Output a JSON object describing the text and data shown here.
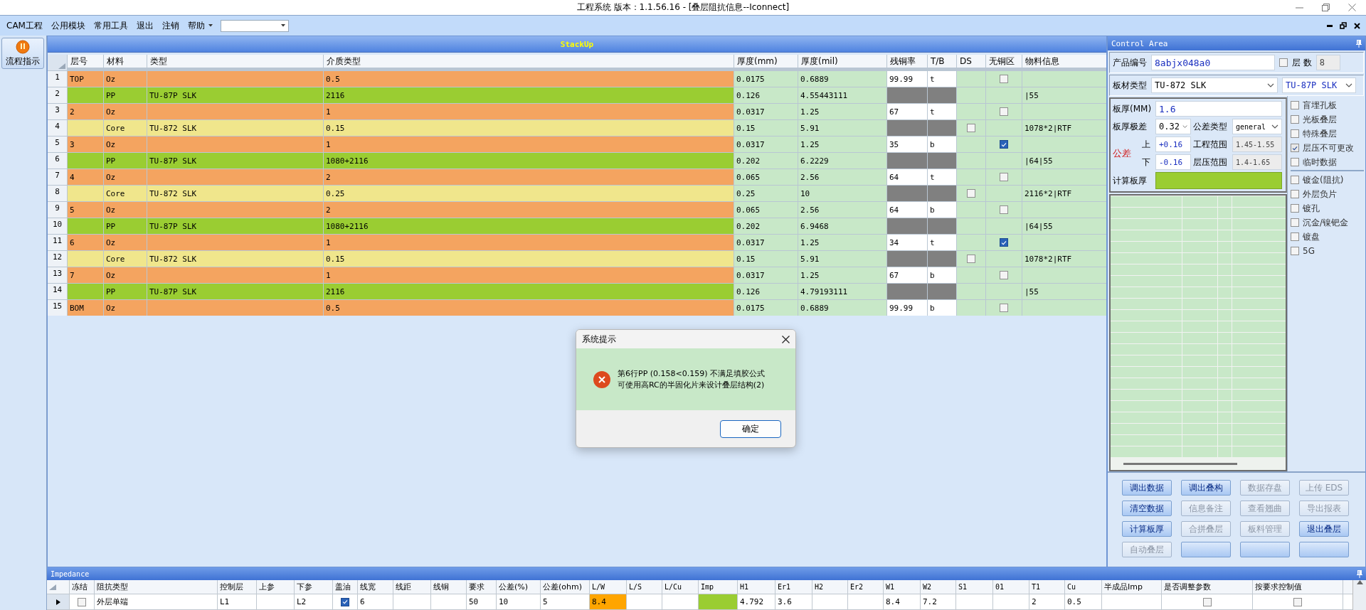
{
  "window": {
    "title": "工程系统   版本：1.1.56.16 - [叠层阻抗信息--Iconnect]"
  },
  "menu": {
    "items": [
      {
        "label": "CAM工程",
        "has_dropdown": false
      },
      {
        "label": "公用模块",
        "has_dropdown": false
      },
      {
        "label": "常用工具",
        "has_dropdown": false
      },
      {
        "label": "退出",
        "has_dropdown": false
      },
      {
        "label": "注销",
        "has_dropdown": false
      },
      {
        "label": "帮助",
        "has_dropdown": true
      }
    ]
  },
  "sidebar": {
    "button": {
      "label": "流程指示"
    }
  },
  "stackup": {
    "title": "StackUp",
    "columns": [
      "层号",
      "材料",
      "类型",
      "介质类型",
      "厚度(mm)",
      "厚度(mil)",
      "残铜率",
      "T/B",
      "DS",
      "无铜区",
      "物料信息"
    ],
    "rows": [
      {
        "no": "1",
        "kind": "copper",
        "layer": "TOP",
        "material": "Oz",
        "dielectric": "0.5",
        "mm": "0.0175",
        "mil": "0.6889",
        "residual": "99.99",
        "tb": "t",
        "no_copper": false
      },
      {
        "no": "2",
        "kind": "pp",
        "material": "PP",
        "type": "TU-87P SLK",
        "dielectric": "2116",
        "mm": "0.126",
        "mil": "4.55443111",
        "info": "|55"
      },
      {
        "no": "3",
        "kind": "copper",
        "layer": "2",
        "material": "Oz",
        "dielectric": "1",
        "mm": "0.0317",
        "mil": "1.25",
        "residual": "67",
        "tb": "t",
        "no_copper": false
      },
      {
        "no": "4",
        "kind": "core",
        "material": "Core",
        "type": "TU-872 SLK",
        "dielectric": "0.15",
        "mm": "0.15",
        "mil": "5.91",
        "ds": false,
        "info": "1078*2|RTF"
      },
      {
        "no": "5",
        "kind": "copper",
        "layer": "3",
        "material": "Oz",
        "dielectric": "1",
        "mm": "0.0317",
        "mil": "1.25",
        "residual": "35",
        "tb": "b",
        "no_copper": true
      },
      {
        "no": "6",
        "kind": "pp",
        "material": "PP",
        "type": "TU-87P SLK",
        "dielectric": "1080+2116",
        "mm": "0.202",
        "mil": "6.2229",
        "info": "|64|55"
      },
      {
        "no": "7",
        "kind": "copper",
        "layer": "4",
        "material": "Oz",
        "dielectric": "2",
        "mm": "0.065",
        "mil": "2.56",
        "residual": "64",
        "tb": "t",
        "no_copper": false
      },
      {
        "no": "8",
        "kind": "core",
        "material": "Core",
        "type": "TU-872 SLK",
        "dielectric": "0.25",
        "mm": "0.25",
        "mil": "10",
        "ds": false,
        "info": "2116*2|RTF"
      },
      {
        "no": "9",
        "kind": "copper",
        "layer": "5",
        "material": "Oz",
        "dielectric": "2",
        "mm": "0.065",
        "mil": "2.56",
        "residual": "64",
        "tb": "b",
        "no_copper": false
      },
      {
        "no": "10",
        "kind": "pp",
        "material": "PP",
        "type": "TU-87P SLK",
        "dielectric": "1080+2116",
        "mm": "0.202",
        "mil": "6.9468",
        "info": "|64|55"
      },
      {
        "no": "11",
        "kind": "copper",
        "layer": "6",
        "material": "Oz",
        "dielectric": "1",
        "mm": "0.0317",
        "mil": "1.25",
        "residual": "34",
        "tb": "t",
        "no_copper": true
      },
      {
        "no": "12",
        "kind": "core",
        "material": "Core",
        "type": "TU-872 SLK",
        "dielectric": "0.15",
        "mm": "0.15",
        "mil": "5.91",
        "ds": false,
        "info": "1078*2|RTF"
      },
      {
        "no": "13",
        "kind": "copper",
        "layer": "7",
        "material": "Oz",
        "dielectric": "1",
        "mm": "0.0317",
        "mil": "1.25",
        "residual": "67",
        "tb": "b",
        "no_copper": false
      },
      {
        "no": "14",
        "kind": "pp",
        "material": "PP",
        "type": "TU-87P SLK",
        "dielectric": "2116",
        "mm": "0.126",
        "mil": "4.79193111",
        "info": "|55"
      },
      {
        "no": "15",
        "kind": "copper",
        "layer": "BOM",
        "material": "Oz",
        "dielectric": "0.5",
        "mm": "0.0175",
        "mil": "0.6889",
        "residual": "99.99",
        "tb": "b",
        "no_copper": false
      }
    ]
  },
  "control_area": {
    "title": "Control Area",
    "product": {
      "label": "产品编号",
      "value": "8abjx048a0"
    },
    "layer_count": {
      "label": "层 数",
      "checked": false,
      "value": "8"
    },
    "material": {
      "label": "板材类型",
      "core": "TU-872 SLK",
      "pp": "TU-87P SLK"
    },
    "thickness": {
      "label": "板厚(MM)",
      "value": "1.6",
      "range_label": "板厚极差",
      "range": "0.32",
      "tol_type_label": "公差类型",
      "tol_type": "general",
      "tol_label": "公差",
      "upper_label": "上",
      "upper": "+0.16",
      "lower_label": "下",
      "lower": "-0.16",
      "eng_label": "工程范围",
      "eng": "1.45-1.55",
      "press_label": "层压范围",
      "press": "1.4-1.65",
      "calc_label": "计算板厚"
    },
    "option_groups": [
      {
        "items": [
          {
            "label": "盲埋孔板",
            "checked": false
          },
          {
            "label": "光板叠层",
            "checked": false
          },
          {
            "label": "特殊叠层",
            "checked": false
          },
          {
            "label": "层压不可更改",
            "checked": true
          },
          {
            "label": "临时数据",
            "checked": false
          }
        ]
      },
      {
        "items": [
          {
            "label": "镀金(阻抗)",
            "checked": false
          },
          {
            "label": "外层负片",
            "checked": false
          },
          {
            "label": "镀孔",
            "checked": false
          },
          {
            "label": "沉金/镍钯金",
            "checked": false
          },
          {
            "label": "镀盘",
            "checked": false
          },
          {
            "label": "5G",
            "checked": false
          }
        ]
      }
    ],
    "buttons": [
      {
        "label": "调出数据",
        "disabled": false
      },
      {
        "label": "调出叠构",
        "disabled": false
      },
      {
        "label": "数据存盘",
        "disabled": true
      },
      {
        "label": "上传 EDS",
        "disabled": true
      },
      {
        "label": "清空数据",
        "disabled": false
      },
      {
        "label": "信息备注",
        "disabled": true
      },
      {
        "label": "查看翘曲",
        "disabled": true
      },
      {
        "label": "导出报表",
        "disabled": true
      },
      {
        "label": "计算板厚",
        "disabled": false
      },
      {
        "label": "合拼叠层",
        "disabled": true
      },
      {
        "label": "板料管理",
        "disabled": true
      },
      {
        "label": "退出叠层",
        "disabled": false
      },
      {
        "label": "自动叠层",
        "disabled": true
      },
      {
        "disabled": false
      },
      {
        "disabled": false
      },
      {
        "disabled": false
      }
    ]
  },
  "impedance": {
    "title": "Impedance",
    "columns": [
      "冻结",
      "阻抗类型",
      "控制层",
      "上参",
      "下参",
      "盖油",
      "线宽",
      "线距",
      "线铜",
      "要求",
      "公差(%)",
      "公差(ohm)",
      "L/W",
      "L/S",
      "L/Cu",
      "Imp",
      "H1",
      "Er1",
      "H2",
      "Er2",
      "W1",
      "W2",
      "S1",
      "01",
      "T1",
      "Cu",
      "半成品Imp",
      "是否调整参数",
      "按要求控制值"
    ],
    "rows": [
      {
        "selected": true,
        "cells": [
          {
            "kind": "check",
            "checked": false
          },
          {
            "kind": "text",
            "text": "外层单端"
          },
          {
            "kind": "text",
            "text": "L1"
          },
          {
            "kind": "blank"
          },
          {
            "kind": "text",
            "text": "L2"
          },
          {
            "kind": "check",
            "checked": true
          },
          {
            "kind": "text",
            "text": "6"
          },
          {
            "kind": "blank"
          },
          {
            "kind": "blank"
          },
          {
            "kind": "text",
            "text": "50"
          },
          {
            "kind": "text",
            "text": "10"
          },
          {
            "kind": "text",
            "text": "5"
          },
          {
            "kind": "warn",
            "text": "8.4"
          },
          {
            "kind": "blank"
          },
          {
            "kind": "blank"
          },
          {
            "kind": "fill"
          },
          {
            "kind": "text",
            "text": "4.792"
          },
          {
            "kind": "text",
            "text": "3.6"
          },
          {
            "kind": "blank"
          },
          {
            "kind": "blank"
          },
          {
            "kind": "text",
            "text": "8.4"
          },
          {
            "kind": "text",
            "text": "7.2"
          },
          {
            "kind": "blank"
          },
          {
            "kind": "blank"
          },
          {
            "kind": "text",
            "text": "2"
          },
          {
            "kind": "text",
            "text": "0.5"
          },
          {
            "kind": "blank"
          },
          {
            "kind": "check",
            "checked": false
          },
          {
            "kind": "check",
            "checked": false
          }
        ]
      }
    ]
  },
  "dialog": {
    "title": "系统提示",
    "lines": [
      "第6行PP (0.158<0.159) 不满足填胶公式",
      "可使用高RC的半固化片来设计叠层结构(2)"
    ],
    "button": "确定"
  }
}
